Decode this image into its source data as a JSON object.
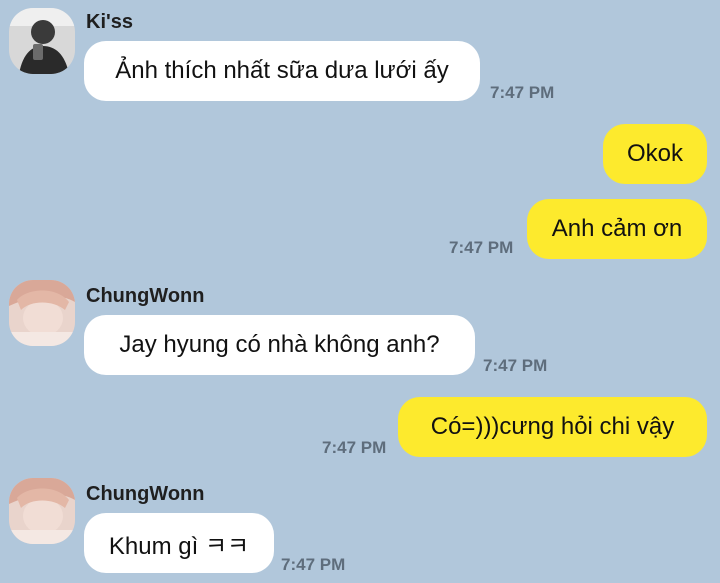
{
  "messages": [
    {
      "sender": "Ki'ss",
      "text": "Ảnh thích nhất sữa dưa lưới ấy",
      "time": "7:47 PM"
    },
    {
      "text": "Okok"
    },
    {
      "text": "Anh cảm ơn",
      "time": "7:47 PM"
    },
    {
      "sender": "ChungWonn",
      "text": "Jay hyung có nhà không anh?",
      "time": "7:47 PM"
    },
    {
      "text": "Có=)))cưng hỏi chi vậy",
      "time": "7:47 PM"
    },
    {
      "sender": "ChungWonn",
      "text": "Khum gì ㅋㅋ",
      "time": "7:47 PM"
    }
  ],
  "colors": {
    "background": "#b1c7db",
    "incoming_bubble": "#ffffff",
    "outgoing_bubble": "#fdea2d",
    "timestamp": "#5e6d7c"
  },
  "icons": [
    "avatar-kiss",
    "avatar-chungwonn"
  ]
}
